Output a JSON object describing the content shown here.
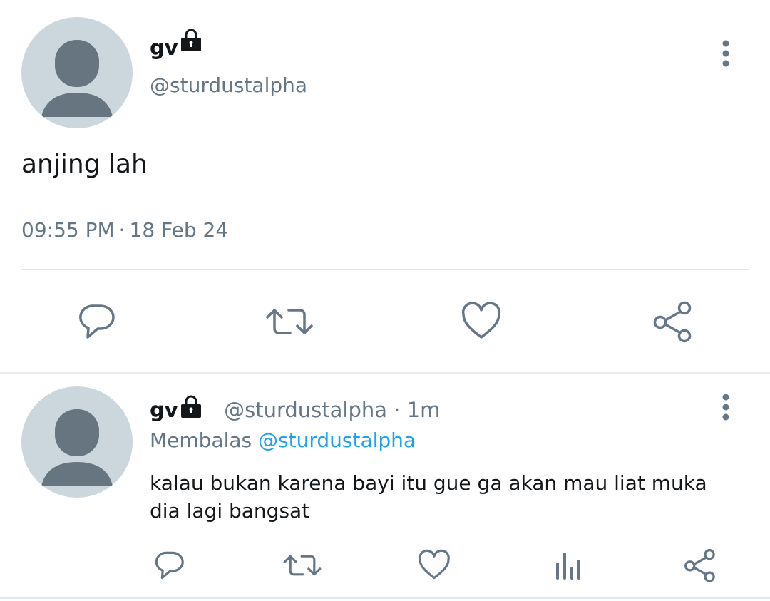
{
  "main_tweet": {
    "display_name": "gv",
    "handle": "@sturdustalpha",
    "text": "anjing lah",
    "time": "09:55 PM",
    "separator": "·",
    "date": "18 Feb 24"
  },
  "reply_tweet": {
    "display_name": "gv",
    "handle": "@sturdustalpha",
    "separator": "·",
    "age": "1m",
    "replying_label": "Membalas",
    "replying_to": "@sturdustalpha",
    "text": "kalau bukan karena bayi itu gue ga akan mau liat muka dia lagi bangsat"
  },
  "colors": {
    "text_primary": "#14171a",
    "text_secondary": "#657786",
    "link": "#1da1f2",
    "avatar_bg": "#ccd6dd",
    "avatar_figure": "#66757f",
    "divider": "#e1e8ed"
  },
  "icons": {
    "lock": "lock-icon",
    "more": "more-vertical-icon",
    "reply": "reply-icon",
    "retweet": "retweet-icon",
    "like": "heart-icon",
    "share": "share-icon",
    "analytics": "analytics-icon"
  }
}
